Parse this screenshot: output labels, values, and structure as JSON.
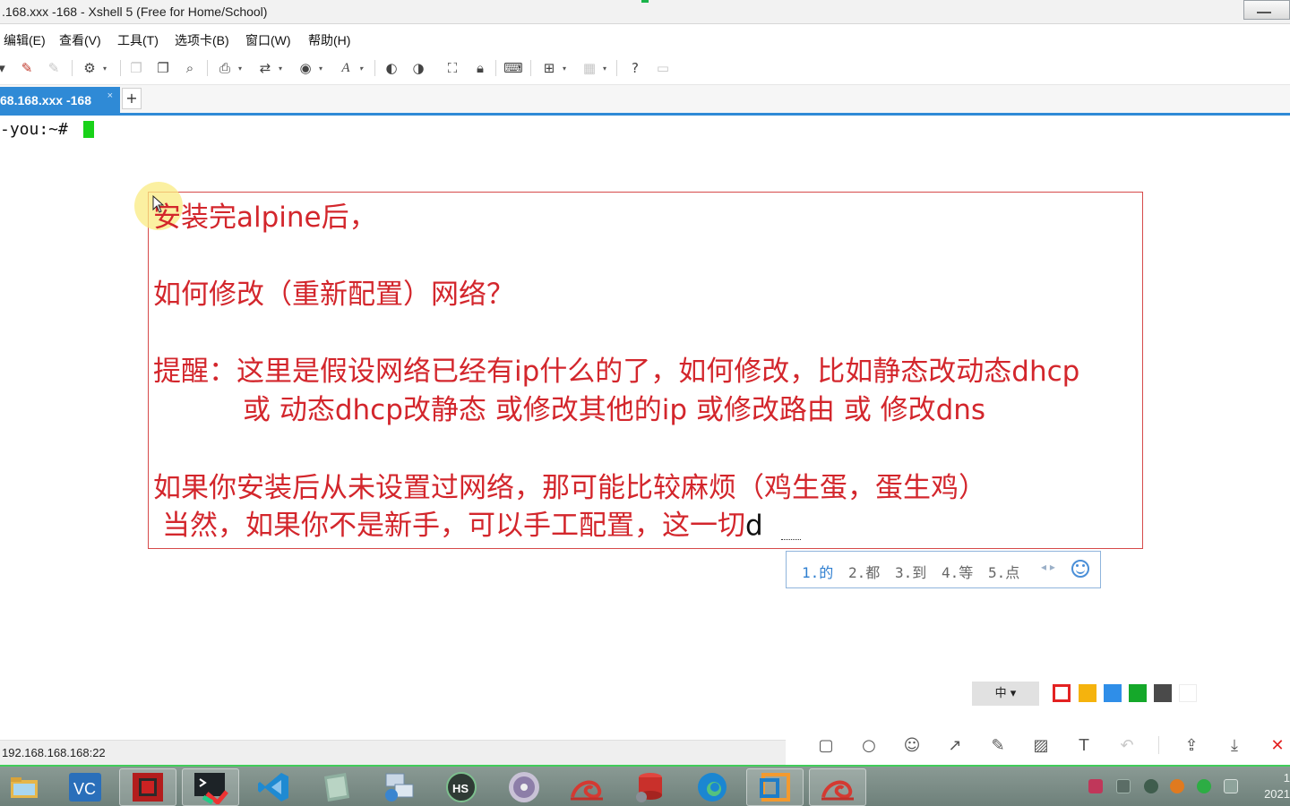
{
  "window": {
    "title": ".168.xxx -168 - Xshell 5 (Free for Home/School)"
  },
  "menu": [
    {
      "id": "edit",
      "label": "编辑(E)"
    },
    {
      "id": "view",
      "label": "查看(V)"
    },
    {
      "id": "tools",
      "label": "工具(T)"
    },
    {
      "id": "tab",
      "label": "选项卡(B)"
    },
    {
      "id": "window",
      "label": "窗口(W)"
    },
    {
      "id": "help",
      "label": "帮助(H)"
    }
  ],
  "tabs": {
    "active_label": "68.168.xxx -168",
    "close_glyph": "×",
    "add_glyph": "+"
  },
  "terminal": {
    "prompt": "-you:~# "
  },
  "annotation": {
    "line1": "安装完alpine后，",
    "line2": "如何修改（重新配置）网络？",
    "line3": "提醒：这里是假设网络已经有ip什么的了，如何修改，比如静态改动态dhcp",
    "line4": "或 动态dhcp改静态 或修改其他的ip 或修改路由  或 修改dns",
    "line5": "如果你安装后从未设置过网络，那可能比较麻烦（鸡生蛋，蛋生鸡）",
    "line6": "当然，如果你不是新手，可以手工配置，这一切",
    "typing": "d"
  },
  "ime": {
    "candidates": [
      "1.的",
      "2.都",
      "3.到",
      "4.等",
      "5.点"
    ],
    "arrows": "◂ ▸"
  },
  "palette": {
    "lang_label": "中 ▾",
    "colors": [
      "#e32222",
      "#f5b30d",
      "#2f8ee8",
      "#15a82a",
      "#4a4a4a",
      "#ffffff"
    ]
  },
  "status": {
    "connection": "192.168.168.168:22"
  },
  "clock": {
    "time": "1",
    "date": "2021"
  }
}
